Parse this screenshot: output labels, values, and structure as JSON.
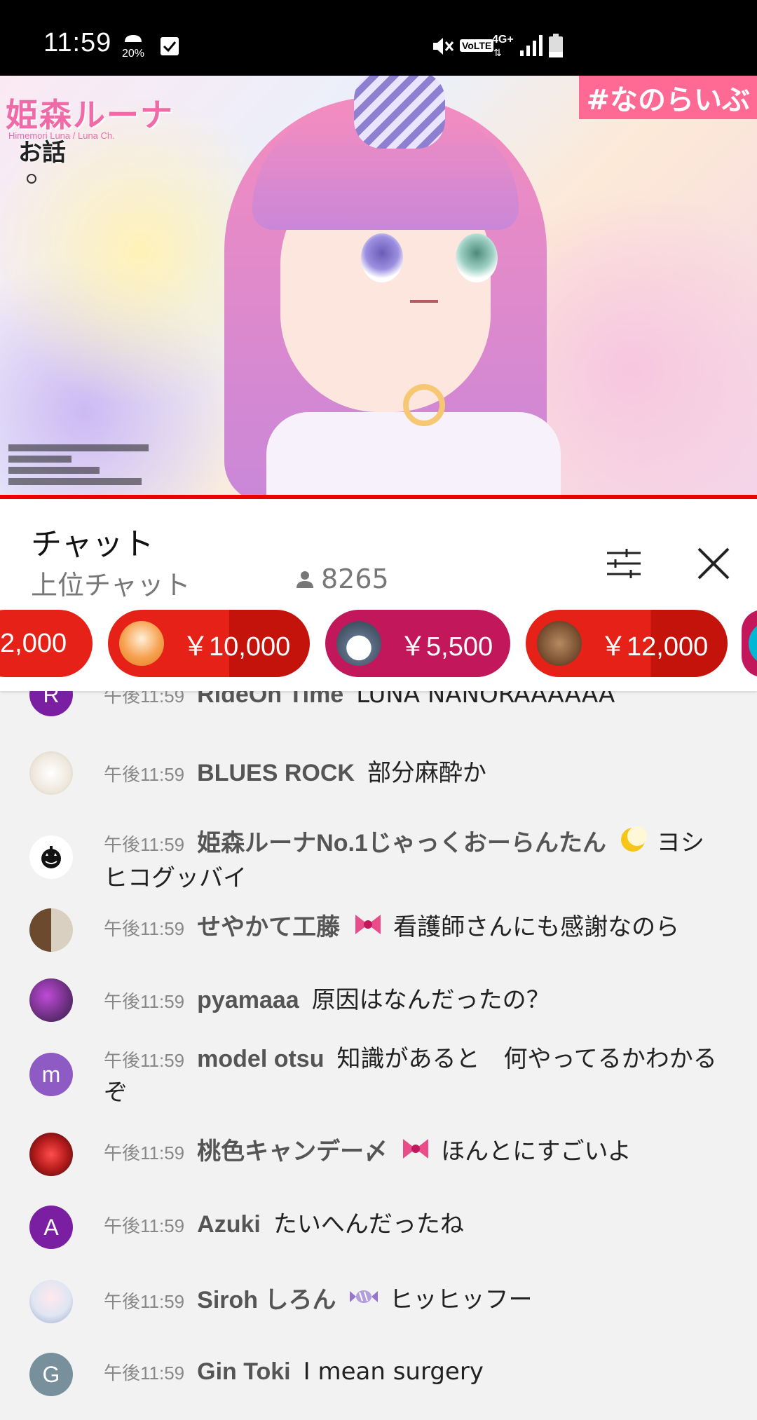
{
  "status_bar": {
    "time": "11:59",
    "battery_saver_percent": "20%",
    "network": "4G+",
    "volte": "VoLTE"
  },
  "video": {
    "logo_text": "姫森ルーナ",
    "logo_subtext": "Himemori Luna / Luna Ch.",
    "overlay_text": "お話",
    "hashtag": "#なのらいぶ",
    "progress_percent": 100
  },
  "chat_header": {
    "title": "チャット",
    "mode": "上位チャット",
    "viewer_count": "8265"
  },
  "tickers": [
    {
      "amount": "2,000",
      "color": "#e62117",
      "has_avatar": false
    },
    {
      "amount": "￥10,000",
      "color": "#e62117",
      "has_avatar": true
    },
    {
      "amount": "￥5,500",
      "color": "#c2185b",
      "has_avatar": true
    },
    {
      "amount": "￥12,000",
      "color": "#e62117",
      "has_avatar": true
    }
  ],
  "messages": [
    {
      "avatar_letter": "R",
      "avatar_color": "#7b1fa2",
      "time": "午後11:59",
      "author": "RideOn Time",
      "text": "LUNA NANORAAAAAA"
    },
    {
      "avatar_letter": "",
      "avatar_color": "#e6e2da",
      "time": "午後11:59",
      "author": "BLUES ROCK",
      "text": "部分麻酔か"
    },
    {
      "avatar_letter": "",
      "avatar_color": "#ffffff",
      "time": "午後11:59",
      "author": "姫森ルーナNo.1じゃっくおーらんたん",
      "emoji": "moon",
      "text": "ヨシヒコグッバイ"
    },
    {
      "avatar_letter": "",
      "avatar_color": "#5d8ca8",
      "time": "午後11:59",
      "author": "せやかて工藤",
      "emoji": "ribbon",
      "text": "看護師さんにも感謝なのら"
    },
    {
      "avatar_letter": "",
      "avatar_color": "#5a2a6e",
      "time": "午後11:59",
      "author": "pyamaaa",
      "text": "原因はなんだったの？"
    },
    {
      "avatar_letter": "m",
      "avatar_color": "#8e5ac4",
      "time": "午後11:59",
      "author": "model otsu",
      "text": "知識があると　何やってるかわかるぞ"
    },
    {
      "avatar_letter": "",
      "avatar_color": "#b71c1c",
      "time": "午後11:59",
      "author": "桃色キャンデー〆",
      "emoji": "ribbon",
      "text": "ほんとにすごいよ"
    },
    {
      "avatar_letter": "A",
      "avatar_color": "#7b1fa2",
      "time": "午後11:59",
      "author": "Azuki",
      "text": "たいへんだったね"
    },
    {
      "avatar_letter": "",
      "avatar_color": "#dfe6f3",
      "time": "午後11:59",
      "author": "Siroh しろん",
      "emoji": "candy",
      "text": "ヒッヒッフー"
    },
    {
      "avatar_letter": "G",
      "avatar_color": "#78909c",
      "time": "午後11:59",
      "author": "Gin Toki",
      "text": "I mean surgery"
    }
  ]
}
